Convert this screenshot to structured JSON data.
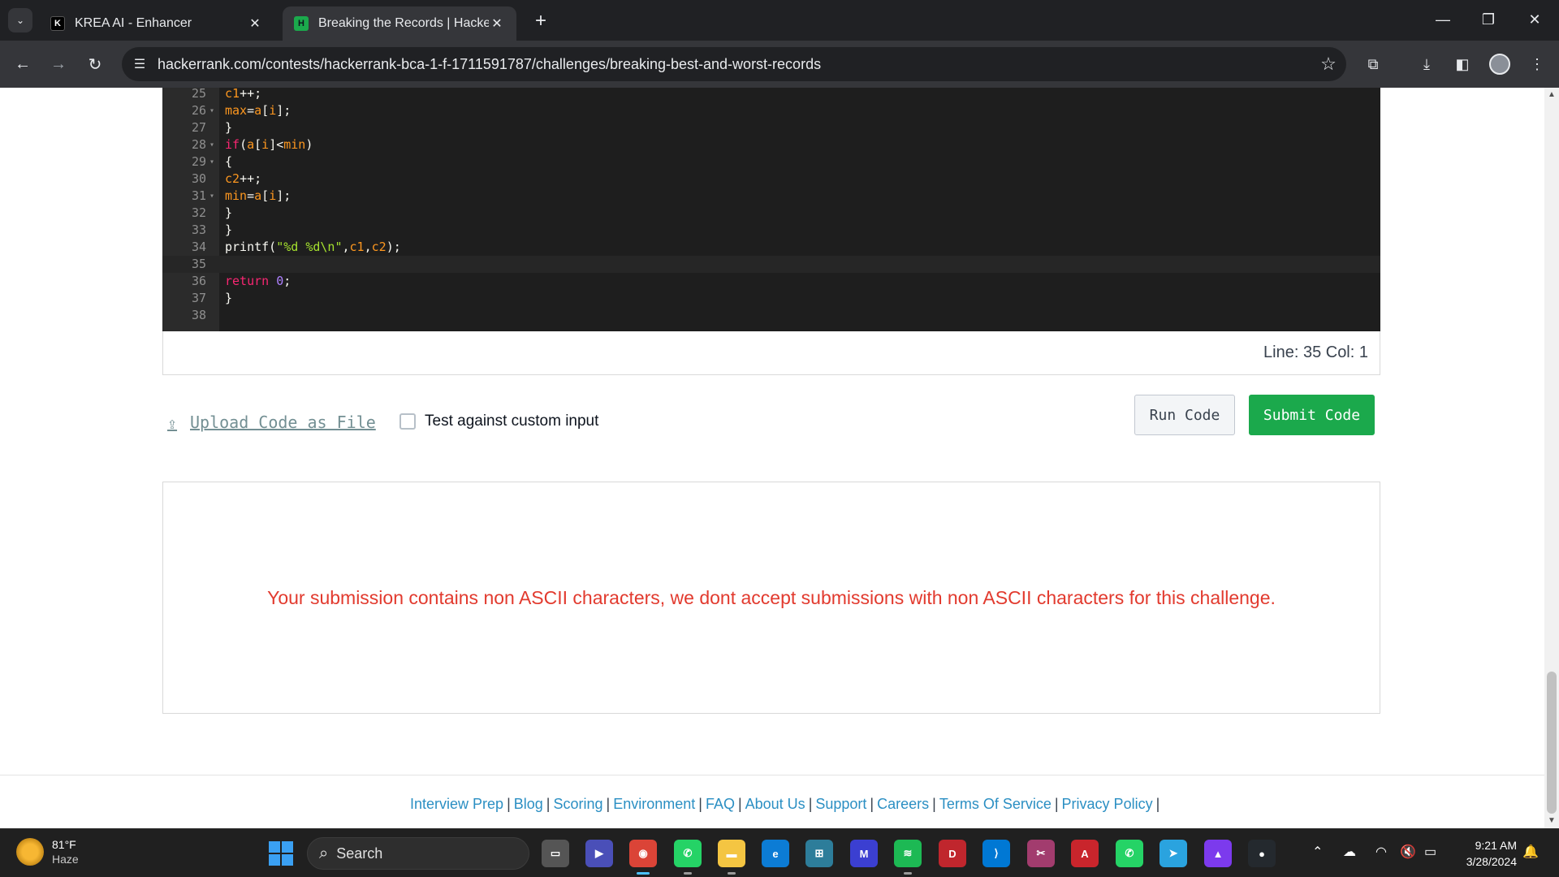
{
  "browser": {
    "tabs": [
      {
        "favicon": "K",
        "title": "KREA AI - Enhancer",
        "active": false
      },
      {
        "favicon": "H",
        "title": "Breaking the Records | HackerRank",
        "active": true
      }
    ],
    "url": "hackerrank.com/contests/hackerrank-bca-1-f-1711591787/challenges/breaking-best-and-worst-records"
  },
  "editor": {
    "lines": [
      {
        "n": "25",
        "fold": "",
        "text": "c1++;"
      },
      {
        "n": "26",
        "fold": "▾",
        "text": "max=a[i];"
      },
      {
        "n": "27",
        "fold": "",
        "text": "}"
      },
      {
        "n": "28",
        "fold": "▾",
        "text": "if(a[i]<min)"
      },
      {
        "n": "29",
        "fold": "▾",
        "text": "{"
      },
      {
        "n": "30",
        "fold": "",
        "text": "c2++;"
      },
      {
        "n": "31",
        "fold": "▾",
        "text": "min=a[i];"
      },
      {
        "n": "32",
        "fold": "",
        "text": "}"
      },
      {
        "n": "33",
        "fold": "",
        "text": "}"
      },
      {
        "n": "34",
        "fold": "",
        "text": "printf(\"%d %d\\n\",c1,c2);"
      },
      {
        "n": "35",
        "fold": "",
        "text": ""
      },
      {
        "n": "36",
        "fold": "",
        "text": "return 0;"
      },
      {
        "n": "37",
        "fold": "",
        "text": "}"
      },
      {
        "n": "38",
        "fold": "",
        "text": ""
      }
    ],
    "current_line": "35",
    "position": "Line: 35 Col: 1"
  },
  "actions": {
    "upload_label": "Upload Code as File",
    "custom_input_label": "Test against custom input",
    "run_label": "Run Code",
    "submit_label": "Submit Code"
  },
  "result": {
    "message": "Your submission contains non ASCII characters, we dont accept submissions with non ASCII characters for this challenge."
  },
  "footer": {
    "links": [
      "Interview Prep",
      "Blog",
      "Scoring",
      "Environment",
      "FAQ",
      "About Us",
      "Support",
      "Careers",
      "Terms Of Service",
      "Privacy Policy"
    ]
  },
  "taskbar": {
    "weather_temp": "81°F",
    "weather_cond": "Haze",
    "search_label": "Search",
    "time": "9:21 AM",
    "date": "3/28/2024",
    "apps": [
      "file-explorer-icon",
      "meet-icon",
      "chrome-icon",
      "whatsapp-icon",
      "folder-icon",
      "edge-icon",
      "store-icon",
      "mathpix-icon",
      "spotify-icon",
      "devcpp-icon",
      "vscode-icon",
      "snipping-icon",
      "acrobat-icon",
      "whatsapp-beta-icon",
      "telegram-icon",
      "arc-icon",
      "github-icon"
    ]
  },
  "colors": {
    "accent_green": "#1ba94c",
    "error_red": "#e23a2e",
    "link_blue": "#2b8fc3"
  }
}
